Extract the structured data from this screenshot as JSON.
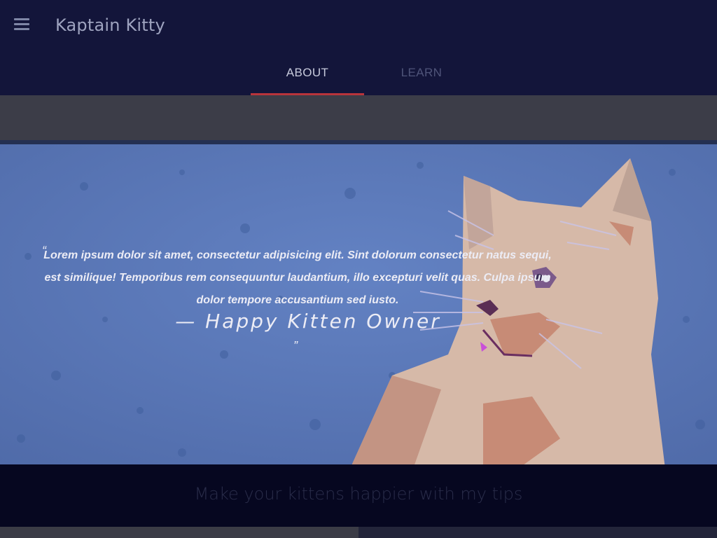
{
  "appbar": {
    "title": "Kaptain Kitty",
    "menu_icon": "hamburger-menu-icon"
  },
  "tabs": [
    {
      "label": "ABOUT",
      "active": true
    },
    {
      "label": "LEARN",
      "active": false
    }
  ],
  "colors": {
    "appbar": "#13153a",
    "accent": "#b9343b",
    "hero_bg": "#5b79b9"
  },
  "hero": {
    "quote_open": "“",
    "quote": "Lorem ipsum dolor sit amet, consectetur adipisicing elit. Sint dolorum consectetur natus sequi, est similique! Temporibus rem consequuntur laudantium, illo excepturi velit quas. Culpa ipsum dolor tempore accusantium sed iusto.",
    "author": "— Happy Kitten Owner",
    "quote_close": "”"
  },
  "tagline": "Make your kittens happier with my tips"
}
